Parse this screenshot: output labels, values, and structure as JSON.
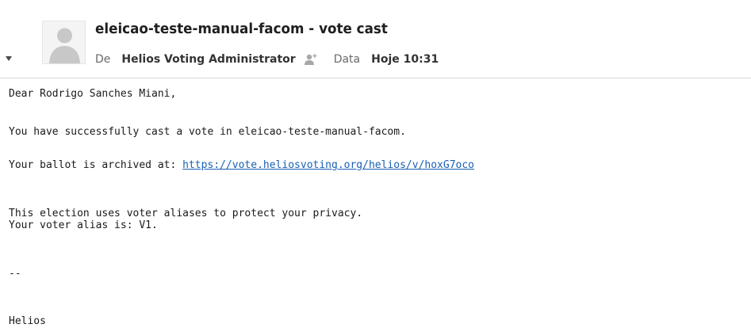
{
  "email": {
    "subject": "eleicao-teste-manual-facom - vote cast",
    "from_label": "De",
    "from_value": "Helios Voting Administrator",
    "date_label": "Data",
    "date_value": "Hoje 10:31"
  },
  "message": {
    "greeting": "Dear Rodrigo Sanches Miani,",
    "line1": "You have successfully cast a vote in eleicao-teste-manual-facom.",
    "archive_prefix": "Your ballot is archived at: ",
    "archive_link": "https://vote.heliosvoting.org/helios/v/hoxG7oco",
    "privacy_line1": "This election uses voter aliases to protect your privacy.",
    "privacy_line2": "Your voter alias is: V1.",
    "separator": "--",
    "signature": "Helios"
  },
  "colors": {
    "link": "#1a5fb4",
    "header_border": "#d6d6d6"
  },
  "icons": [
    "chevron-down-icon",
    "avatar",
    "add-contact-icon"
  ]
}
